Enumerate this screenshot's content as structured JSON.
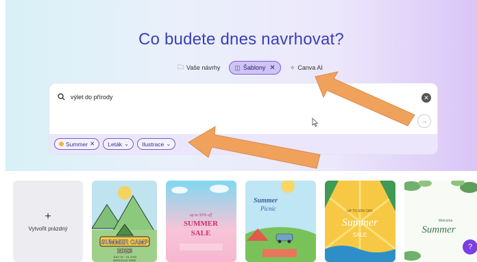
{
  "headline": "Co budete dnes navrhovat?",
  "tabs": [
    {
      "label": "Vaše návrhy",
      "icon": "folder-icon"
    },
    {
      "label": "Šablony",
      "icon": "template-icon",
      "active": true
    },
    {
      "label": "Canva AI",
      "icon": "sparkle-icon"
    }
  ],
  "search": {
    "value": "výlet do přírody"
  },
  "filters": [
    {
      "label": "Summer",
      "icon": "sun-icon",
      "removable": true
    },
    {
      "label": "Leták",
      "dropdown": true
    },
    {
      "label": "Ilustrace",
      "dropdown": true
    }
  ],
  "create_blank": {
    "label": "Vytvořit prázdný"
  },
  "templates": [
    {
      "name": "summer-camp",
      "text": [
        "SUMMER CAMP",
        "2023",
        "JULY 10 - 15, 2023",
        "BORCELLE PARK"
      ]
    },
    {
      "name": "summer-sale",
      "text": [
        "up to 50% off",
        "SUMMER",
        "SALE"
      ]
    },
    {
      "name": "summer-picnic",
      "text": [
        "Summer",
        "Picnic"
      ]
    },
    {
      "name": "summer-sale-2",
      "text": [
        "UP TO 50% OFF",
        "Summer",
        "SALE"
      ]
    },
    {
      "name": "welcome-summer",
      "text": [
        "Welcome",
        "Summer"
      ]
    }
  ],
  "help_label": "?",
  "colors": {
    "accent": "#7b61d6",
    "headline": "#3a3fb5",
    "arrow": "#f0a25c"
  }
}
